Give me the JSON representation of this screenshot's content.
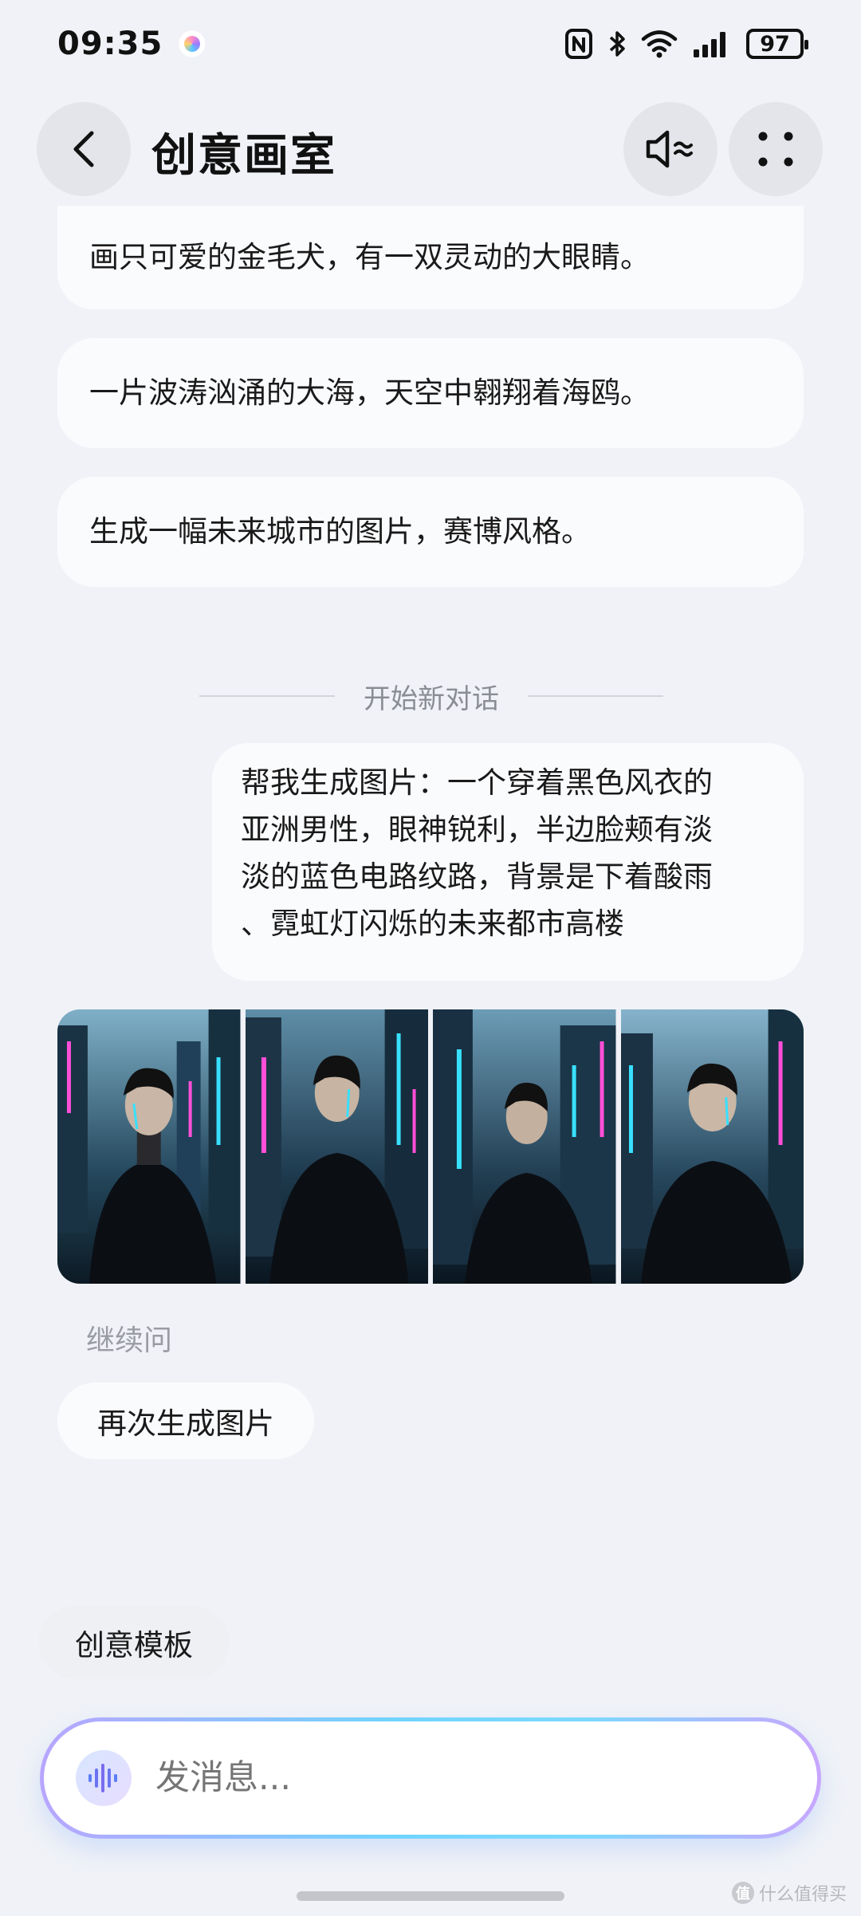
{
  "status_bar": {
    "time": "09:35",
    "battery": "97"
  },
  "header": {
    "title": "创意画室",
    "back_icon": "chevron-left-icon",
    "speaker_icon": "speaker-toggle-icon",
    "more_icon": "four-dots-icon"
  },
  "history": [
    {
      "text": "画只可爱的金毛犬，有一双灵动的大眼睛。"
    },
    {
      "text": "一片波涛汹涌的大海，天空中翱翔着海鸥。"
    },
    {
      "text": "生成一幅未来城市的图片，赛博风格。"
    }
  ],
  "divider": {
    "label": "开始新对话"
  },
  "user_message": {
    "lines": [
      "帮我生成图片：一个穿着黑色风衣的",
      "亚洲男性，眼神锐利，半边脸颊有淡",
      "淡的蓝色电路纹路，背景是下着酸雨",
      "、霓虹灯闪烁的未来都市高楼"
    ]
  },
  "generated_images": {
    "count": 4,
    "subject": "man-in-black-trench-coat-neon-city"
  },
  "followup": {
    "label": "继续问",
    "chips": [
      {
        "label": "再次生成图片"
      }
    ]
  },
  "template_chip": {
    "label": "创意模板"
  },
  "input": {
    "placeholder": "发消息...",
    "voice_icon": "voice-wave-icon"
  },
  "watermark": {
    "text": "什么值得买",
    "badge": "值"
  },
  "colors": {
    "background": "#f0f2f7",
    "bubble": "#fafbfd",
    "accent_gradient_start": "#b8a6ff",
    "accent_gradient_mid": "#6fd4ff",
    "neon_cyan": "#38e0ff",
    "neon_magenta": "#ff4fd8"
  }
}
